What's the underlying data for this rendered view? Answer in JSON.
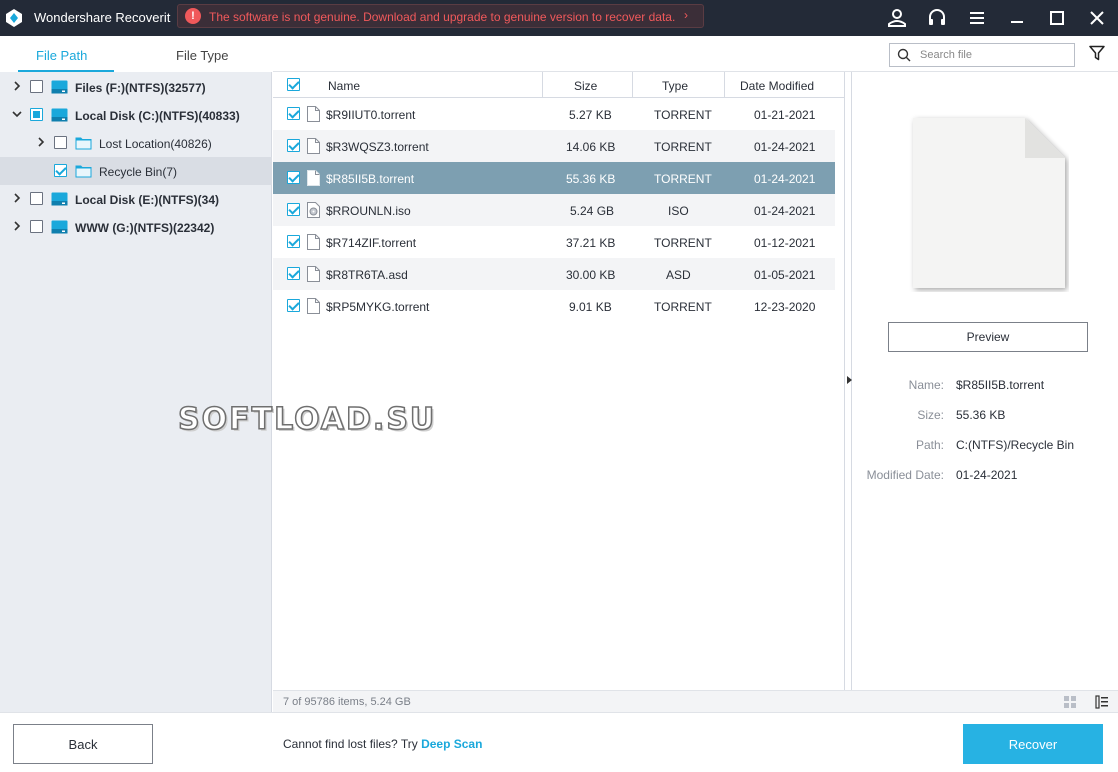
{
  "titlebar": {
    "app_title": "Wondershare Recoverit",
    "warning": "The software is not genuine. Download and upgrade to genuine version to recover data.",
    "warning_icon": "!",
    "icons": [
      "account-icon",
      "support-headset-icon",
      "menu-icon",
      "minimize-icon",
      "maximize-icon",
      "close-icon"
    ]
  },
  "left_tabs": {
    "file_path": "File Path",
    "file_type": "File Type",
    "accent_color": "#1aa8db"
  },
  "tree": [
    {
      "label": "Files (F:)(NTFS)(32577)",
      "checked": "none",
      "expanded": false
    },
    {
      "label": "Local Disk (C:)(NTFS)(40833)",
      "checked": "partial",
      "expanded": true
    },
    {
      "label": "Lost Location(40826)",
      "checked": "none",
      "expanded": false
    },
    {
      "label": "Recycle Bin(7)",
      "checked": "checked",
      "selected": true
    },
    {
      "label": "Local Disk (E:)(NTFS)(34)",
      "checked": "none",
      "expanded": false
    },
    {
      "label": "WWW (G:)(NTFS)(22342)",
      "checked": "none",
      "expanded": false
    }
  ],
  "search": {
    "placeholder": "Search file"
  },
  "table": {
    "headers": {
      "name": "Name",
      "size": "Size",
      "type": "Type",
      "date": "Date Modified"
    },
    "rows": [
      {
        "name": "$R9IIUT0.torrent",
        "size": "5.27 KB",
        "type": "TORRENT",
        "date": "01-21-2021"
      },
      {
        "name": "$R3WQSZ3.torrent",
        "size": "14.06 KB",
        "type": "TORRENT",
        "date": "01-24-2021"
      },
      {
        "name": "$R85II5B.torrent",
        "size": "55.36 KB",
        "type": "TORRENT",
        "date": "01-24-2021"
      },
      {
        "name": "$RROUNLN.iso",
        "size": "5.24 GB",
        "type": "ISO",
        "date": "01-24-2021"
      },
      {
        "name": "$R714ZIF.torrent",
        "size": "37.21 KB",
        "type": "TORRENT",
        "date": "01-12-2021"
      },
      {
        "name": "$R8TR6TA.asd",
        "size": "30.00 KB",
        "type": "ASD",
        "date": "01-05-2021"
      },
      {
        "name": "$RP5MYKG.torrent",
        "size": "9.01 KB",
        "type": "TORRENT",
        "date": "12-23-2020"
      }
    ],
    "selected_row_color": "#7d9fb1"
  },
  "preview": {
    "button_label": "Preview",
    "props": {
      "name_label": "Name:",
      "name_value": "$R85II5B.torrent",
      "size_label": "Size:",
      "size_value": "55.36 KB",
      "path_label": "Path:",
      "path_value": "C:(NTFS)/Recycle Bin",
      "date_label": "Modified Date:",
      "date_value": "01-24-2021"
    }
  },
  "status": {
    "text": "7 of 95786 items, 5.24 GB"
  },
  "bottom": {
    "back_label": "Back",
    "hint_text": "Cannot find lost files? Try",
    "deep_scan_label": "Deep Scan",
    "recover_label": "Recover",
    "recover_color": "#27b2e3"
  },
  "watermark": "SOFTLOAD.SU"
}
